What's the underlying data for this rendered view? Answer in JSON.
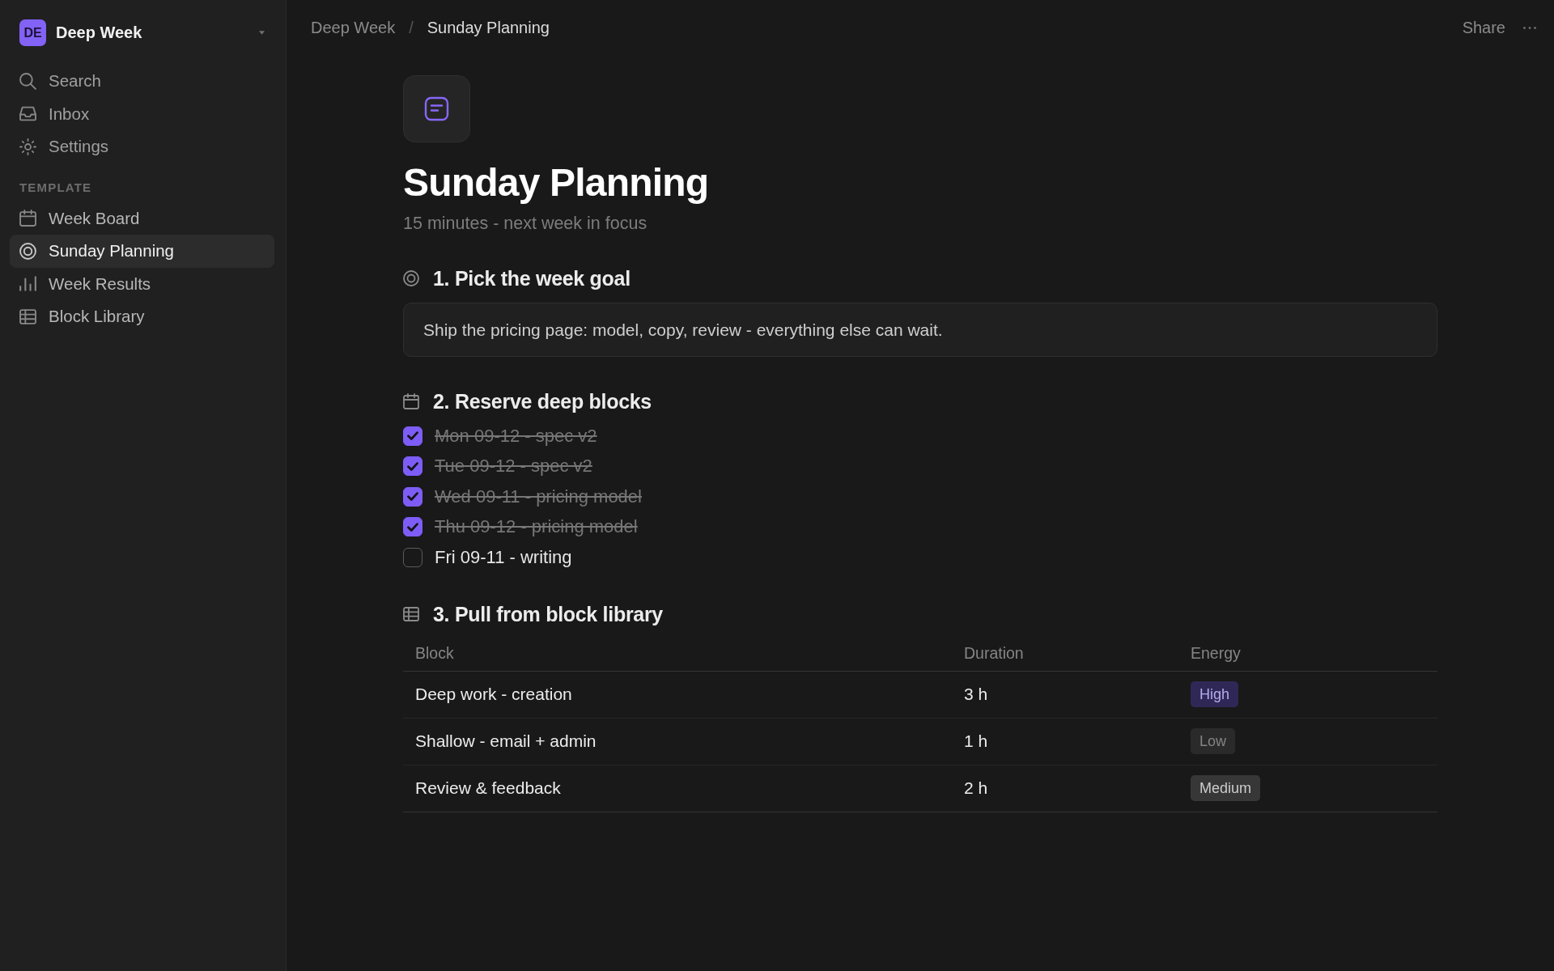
{
  "sidebar": {
    "workspace": {
      "initials": "DE",
      "name": "Deep Week"
    },
    "nav": [
      {
        "label": "Search"
      },
      {
        "label": "Inbox"
      },
      {
        "label": "Settings"
      }
    ],
    "section_label": "TEMPLATE",
    "pages": [
      {
        "label": "Week Board",
        "selected": false
      },
      {
        "label": "Sunday Planning",
        "selected": true
      },
      {
        "label": "Week Results",
        "selected": false
      },
      {
        "label": "Block Library",
        "selected": false
      }
    ]
  },
  "topbar": {
    "breadcrumb": [
      {
        "label": "Deep Week"
      },
      {
        "label": "Sunday Planning"
      }
    ],
    "separator": "/",
    "share": "Share"
  },
  "page": {
    "title": "Sunday Planning",
    "subtitle": "15 minutes - next week in focus",
    "sections": [
      {
        "kind": "callout",
        "heading": "1. Pick the week goal",
        "text": "Ship the pricing page: model, copy, review - everything else can wait."
      },
      {
        "kind": "checklist",
        "heading": "2. Reserve deep blocks",
        "items": [
          {
            "text": "Mon 09-12 - spec v2",
            "checked": true
          },
          {
            "text": "Tue 09-12 - spec v2",
            "checked": true
          },
          {
            "text": "Wed 09-11 - pricing model",
            "checked": true
          },
          {
            "text": "Thu 09-12 - pricing model",
            "checked": true
          },
          {
            "text": "Fri 09-11 - writing",
            "checked": false
          }
        ]
      },
      {
        "kind": "table",
        "heading": "3. Pull from block library",
        "columns": [
          "Block",
          "Duration",
          "Energy"
        ],
        "rows": [
          {
            "block": "Deep work - creation",
            "duration": "3 h",
            "energy": {
              "label": "High",
              "color": "#2f2857"
            }
          },
          {
            "block": "Shallow - email + admin",
            "duration": "1 h",
            "energy": {
              "label": "Low",
              "color": "#2a2a2a"
            }
          },
          {
            "block": "Review & feedback",
            "duration": "2 h",
            "energy": {
              "label": "Medium",
              "color": "#373737"
            }
          }
        ]
      }
    ]
  }
}
